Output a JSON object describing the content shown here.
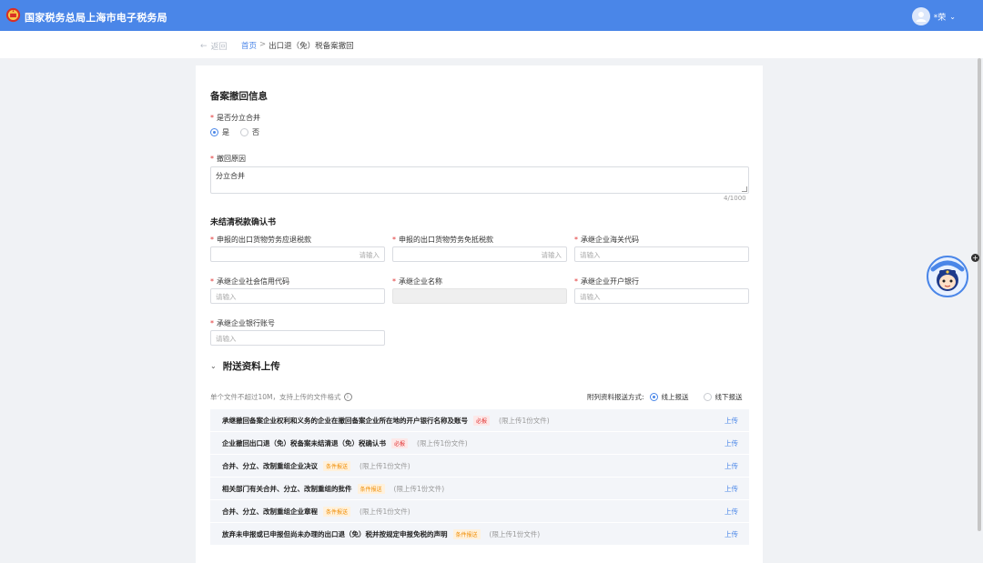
{
  "header": {
    "title": "国家税务总局上海市电子税务局",
    "user_name": "*荣"
  },
  "nav": {
    "back_label": "返回",
    "breadcrumb": {
      "home": "首页",
      "sep": ">",
      "current": "出口退（免）税备案撤回"
    }
  },
  "revoke_section": {
    "title": "备案撤回信息",
    "merge_label": "是否分立合并",
    "merge_options": {
      "yes": "是",
      "no": "否"
    },
    "merge_selected": "是",
    "reason_label": "撤回原因",
    "reason_value": "分立合并",
    "reason_counter": "4/1000"
  },
  "confirm_section": {
    "title": "未结清税款确认书",
    "fields": {
      "refund_tax": {
        "label": "申报的出口货物劳务应退税款",
        "placeholder": "请输入"
      },
      "offset_tax": {
        "label": "申报的出口货物劳务免抵税款",
        "placeholder": "请输入"
      },
      "customs_code": {
        "label": "承继企业海关代码",
        "placeholder": "请输入"
      },
      "credit_code": {
        "label": "承继企业社会信用代码",
        "placeholder": "请输入"
      },
      "company_name": {
        "label": "承继企业名称",
        "placeholder": ""
      },
      "bank": {
        "label": "承继企业开户银行",
        "placeholder": "请输入"
      },
      "account": {
        "label": "承继企业银行账号",
        "placeholder": "请输入"
      }
    }
  },
  "upload_section": {
    "title": "附送资料上传",
    "hint": "单个文件不超过10M，支持上传的文件格式",
    "method_label": "附列资料报送方式:",
    "method_online": "线上报送",
    "method_offline": "线下报送",
    "upload_label": "上传",
    "rows": [
      {
        "name": "承继撤回备案企业权利和义务的企业在撤回备案企业所在地的开户银行名称及账号",
        "tag": "必报",
        "limit": "(限上传1份文件)"
      },
      {
        "name": "企业撤回出口退（免）税备案未结清退（免）税确认书",
        "tag": "必报",
        "limit": "(限上传1份文件)"
      },
      {
        "name": "合并、分立、改制重组企业决议",
        "tag": "条件报送",
        "limit": "(限上传1份文件)"
      },
      {
        "name": "相关部门有关合并、分立、改制重组的批件",
        "tag": "条件报送",
        "limit": "(限上传1份文件)"
      },
      {
        "name": "合并、分立、改制重组企业章程",
        "tag": "条件报送",
        "limit": "(限上传1份文件)"
      },
      {
        "name": "放弃未申报或已申报但尚未办理的出口退（免）税并按规定申报免税的声明",
        "tag": "条件报送",
        "limit": "(限上传1份文件)"
      }
    ]
  },
  "colors": {
    "primary": "#4a86e8",
    "required": "#e03131",
    "conditional": "#f08c00"
  }
}
